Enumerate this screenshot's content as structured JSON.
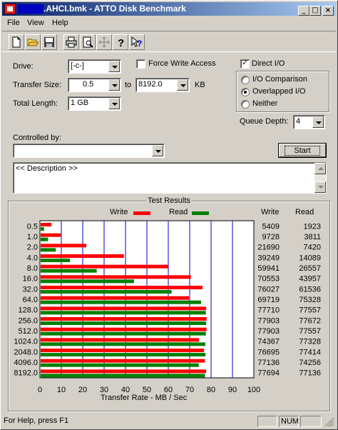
{
  "window": {
    "title": ".AHCI.bmk - ATTO Disk Benchmark",
    "controls": {
      "minimize": "_",
      "maximize": "□",
      "close": "×"
    }
  },
  "menu": [
    "File",
    "View",
    "Help"
  ],
  "toolbar": {
    "icons": [
      "new-document-icon",
      "open-folder-icon",
      "save-icon",
      "print-icon",
      "print-preview-icon",
      "move-icon",
      "help-icon",
      "context-help-icon"
    ]
  },
  "settings": {
    "drive_label": "Drive:",
    "drive_value": "[-c-]",
    "transfer_size_label": "Transfer Size:",
    "transfer_from": "0.5",
    "to_label": "to",
    "transfer_to": "8192.0",
    "kb_label": "KB",
    "total_length_label": "Total Length:",
    "total_length_value": "1 GB",
    "force_write_access": "Force Write Access",
    "force_write_checked": false,
    "direct_io": "Direct I/O",
    "direct_io_checked": true,
    "io_comparison": "I/O Comparison",
    "overlapped_io": "Overlapped I/O",
    "neither": "Neither",
    "selected_io_mode": "overlapped",
    "queue_depth_label": "Queue Depth:",
    "queue_depth_value": "4",
    "controlled_by_label": "Controlled by:",
    "controlled_by_value": "",
    "start_button": "Start",
    "description": "<< Description >>"
  },
  "results": {
    "group_title": "Test Results",
    "legend_write": "Write",
    "legend_read": "Read",
    "col_write": "Write",
    "col_read": "Read",
    "rows": [
      {
        "size": "0.5",
        "write": "5409",
        "read": "1923"
      },
      {
        "size": "1.0",
        "write": "9728",
        "read": "3811"
      },
      {
        "size": "2.0",
        "write": "21690",
        "read": "7420"
      },
      {
        "size": "4.0",
        "write": "39249",
        "read": "14089"
      },
      {
        "size": "8.0",
        "write": "59941",
        "read": "26557"
      },
      {
        "size": "16.0",
        "write": "70553",
        "read": "43957"
      },
      {
        "size": "32.0",
        "write": "76027",
        "read": "61536"
      },
      {
        "size": "64.0",
        "write": "69719",
        "read": "75328"
      },
      {
        "size": "128.0",
        "write": "77710",
        "read": "77557"
      },
      {
        "size": "256.0",
        "write": "77903",
        "read": "77672"
      },
      {
        "size": "512.0",
        "write": "77903",
        "read": "77557"
      },
      {
        "size": "1024.0",
        "write": "74367",
        "read": "77328"
      },
      {
        "size": "2048.0",
        "write": "76695",
        "read": "77414"
      },
      {
        "size": "4096.0",
        "write": "77136",
        "read": "74256"
      },
      {
        "size": "8192.0",
        "write": "77694",
        "read": "77136"
      }
    ]
  },
  "chart_data": {
    "type": "bar",
    "orientation": "horizontal",
    "categories": [
      "0.5",
      "1.0",
      "2.0",
      "4.0",
      "8.0",
      "16.0",
      "32.0",
      "64.0",
      "128.0",
      "256.0",
      "512.0",
      "1024.0",
      "2048.0",
      "4096.0",
      "8192.0"
    ],
    "series": [
      {
        "name": "Write",
        "color": "#ff0000",
        "values": [
          5.409,
          9.728,
          21.69,
          39.249,
          59.941,
          70.553,
          76.027,
          69.719,
          77.71,
          77.903,
          77.903,
          74.367,
          76.695,
          77.136,
          77.694
        ]
      },
      {
        "name": "Read",
        "color": "#008000",
        "values": [
          1.923,
          3.811,
          7.42,
          14.089,
          26.557,
          43.957,
          61.536,
          75.328,
          77.557,
          77.672,
          77.557,
          77.328,
          77.414,
          74.256,
          77.136
        ]
      }
    ],
    "xlabel": "Transfer Rate - MB / Sec",
    "xlim": [
      0,
      100
    ],
    "xticks": [
      "0",
      "10",
      "20",
      "30",
      "40",
      "50",
      "60",
      "70",
      "80",
      "90",
      "100"
    ],
    "grid": true,
    "grid_color": "#0000c0",
    "legend": "top"
  },
  "status": {
    "help_text": "For Help, press F1",
    "num": "NUM"
  }
}
